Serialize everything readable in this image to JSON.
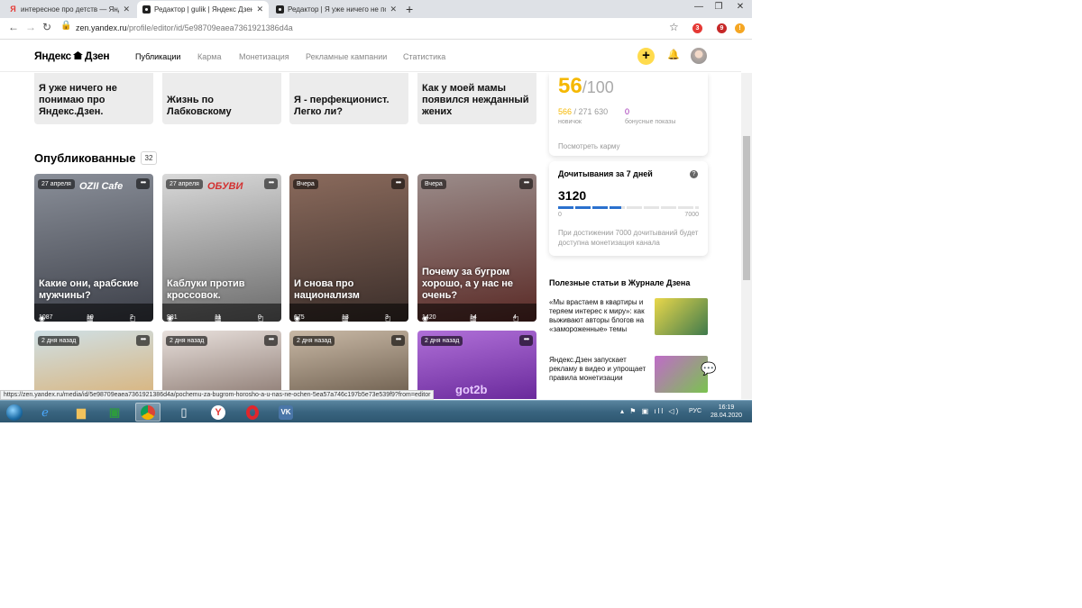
{
  "browser": {
    "tabs": [
      {
        "title": "интересное про детств — Яндек",
        "active": false,
        "icon": "yandex-icon"
      },
      {
        "title": "Редактор | gulik | Яндекс Дзен",
        "active": true,
        "icon": "dzen-icon"
      },
      {
        "title": "Редактор | Я уже ничего не пон",
        "active": false,
        "icon": "dzen-icon"
      }
    ],
    "url_host": "zen.yandex.ru",
    "url_path": "/profile/editor/id/5e98709eaea7361921386d4a",
    "extensions": [
      "3",
      "9"
    ]
  },
  "header": {
    "logo": "Яндекс",
    "logo_suffix": "Дзен",
    "nav": [
      {
        "label": "Публикации",
        "active": true
      },
      {
        "label": "Карма",
        "active": false
      },
      {
        "label": "Монетизация",
        "active": false
      },
      {
        "label": "Рекламные кампании",
        "active": false
      },
      {
        "label": "Статистика",
        "active": false
      }
    ],
    "add_label": "+"
  },
  "drafts": [
    {
      "title": "Я уже ничего не понимаю про Яндекс.Дзен."
    },
    {
      "title": "Жизнь по Лабковскому"
    },
    {
      "title": "Я - перфекционист. Легко ли?"
    },
    {
      "title": "Как у моей мамы появился нежданный жених"
    }
  ],
  "published": {
    "heading": "Опубликованные",
    "count": "32",
    "cards": [
      {
        "date": "27 апреля",
        "title": "Какие они, арабские мужчины?",
        "views": "1087",
        "reads": "10",
        "comments": "2",
        "bg_from": "#8a8f99",
        "bg_to": "#3c3f48",
        "img_text": "OZII Cafe"
      },
      {
        "date": "27 апреля",
        "title": "Каблуки против кроссовок.",
        "views": "981",
        "reads": "11",
        "comments": "0",
        "bg_from": "#d9d9d9",
        "bg_to": "#6b6b6b",
        "img_text": "ОБУВИ"
      },
      {
        "date": "Вчера",
        "title": "И снова про национализм",
        "views": "675",
        "reads": "13",
        "comments": "3",
        "bg_from": "#8a6a5c",
        "bg_to": "#3b2e2a",
        "img_text": ""
      },
      {
        "date": "Вчера",
        "title": "Почему за бугром хорошо, а у нас не очень?",
        "views": "1420",
        "reads": "14",
        "comments": "4",
        "bg_from": "#9b8c8a",
        "bg_to": "#5a2a26",
        "img_text": ""
      }
    ],
    "cards_row2": [
      {
        "date": "2 дня назад",
        "bg_from": "#cfe0e6",
        "bg_to": "#d9b37a"
      },
      {
        "date": "2 дня назад",
        "bg_from": "#e8e0dc",
        "bg_to": "#8d7b73"
      },
      {
        "date": "2 дня назад",
        "bg_from": "#c9b9a6",
        "bg_to": "#6c5d4d"
      },
      {
        "date": "2 дня назад",
        "bg_from": "#b070d8",
        "bg_to": "#6a2a9c",
        "img_text": "got2b"
      }
    ]
  },
  "karma": {
    "score": "56",
    "score_max": "/100",
    "views_current": "566",
    "views_total": "/ 271 630",
    "views_label": "новичок",
    "bonus": "0",
    "bonus_label": "бонусные показы",
    "link": "Посмотреть карму"
  },
  "reads": {
    "title": "Дочитывания за 7 дней",
    "value": "3120",
    "min": "0",
    "max": "7000",
    "progress": 0.446,
    "note": "При достижении 7000 дочитываний будет доступна монетизация канала"
  },
  "journal": {
    "heading": "Полезные статьи в Журнале Дзена",
    "items": [
      {
        "text": "«Мы врастаем в квартиры и теряем интерес к миру»: как выживают авторы блогов на «замороженные» темы",
        "img_from": "#e9d74b",
        "img_to": "#3f7a4c"
      },
      {
        "text": "Яндекс.Дзен запускает рекламу в видео и упрощает правила монетизации",
        "img_from": "#c06bc9",
        "img_to": "#7ac34f"
      }
    ]
  },
  "status_url": "https://zen.yandex.ru/media/id/5e98709eaea7361921386d4a/pochemu-za-bugrom-horosho-a-u-nas-ne-ochen-5ea57a746c197b5e73e539f9?from=editor",
  "taskbar": {
    "lang": "РУС",
    "time": "16:19",
    "date": "28.04.2020"
  },
  "colors": {
    "accent_yellow": "#ffdb4d",
    "karma_yellow": "#f5b800",
    "bonus_purple": "#9c27b0",
    "progress_blue": "#2b71ce"
  }
}
